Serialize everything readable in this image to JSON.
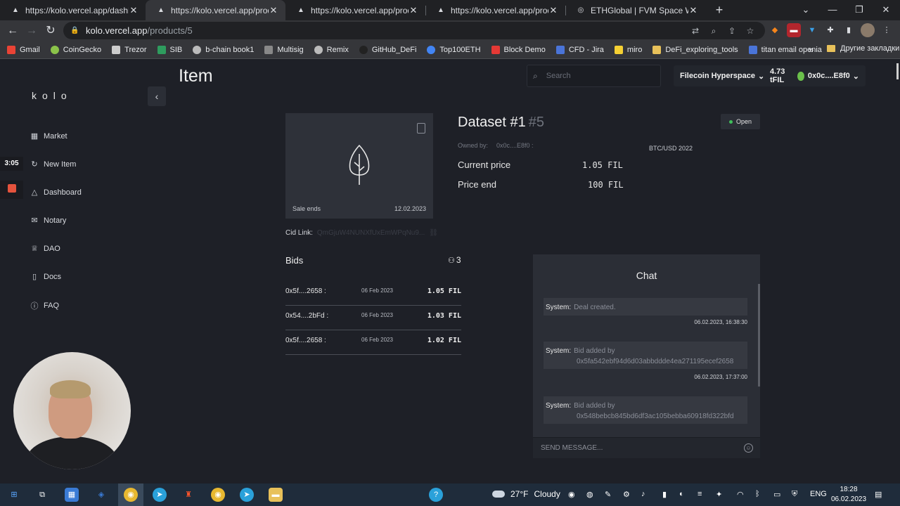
{
  "browser": {
    "tabs": [
      {
        "title": "https://kolo.vercel.app/dashboar",
        "close": "✕",
        "icon": "▲"
      },
      {
        "title": "https://kolo.vercel.app/products/",
        "close": "✕",
        "icon": "▲"
      },
      {
        "title": "https://kolo.vercel.app/products/",
        "close": "✕",
        "icon": "▲"
      },
      {
        "title": "https://kolo.vercel.app/products/",
        "close": "✕",
        "icon": "▲"
      },
      {
        "title": "ETHGlobal | FVM Space Warp",
        "close": "✕",
        "icon": "◎"
      }
    ],
    "new_tab": "+",
    "url_host": "kolo.vercel.app",
    "url_path": "/products/5",
    "bookmarks": [
      "Gmail",
      "CoinGecko",
      "Trezor",
      "SIB",
      "b-chain book1",
      "Multisig",
      "Remix",
      "GitHub_DeFi",
      "Top100ETH",
      "Block Demo",
      "CFD - Jira",
      "miro",
      "DeFi_exploring_tools",
      "titan email openia"
    ],
    "bookmarks_more": "»",
    "other_bookmarks": "Другие закладки",
    "bookmark_colors": [
      "#ea4335",
      "#8bc34a",
      "#cccccc",
      "#2e9c5e",
      "#bbbbbb",
      "#888888",
      "#bbbbbb",
      "#222222",
      "#4285f4",
      "#e53935",
      "#4a74d8",
      "#f5d033",
      "#e8c15a",
      "#4a74d8"
    ]
  },
  "recording": {
    "time": "3:05"
  },
  "app": {
    "logo": "kolo",
    "page_title": "Item",
    "search_placeholder": "Search",
    "network": "Filecoin Hyperspace",
    "balance": "4.73 tFIL",
    "wallet": "0x0c....E8f0",
    "nav": [
      {
        "label": "Market",
        "icon": "grid-icon"
      },
      {
        "label": "New Item",
        "icon": "refresh-icon"
      },
      {
        "label": "Dashboard",
        "icon": "bell-icon"
      },
      {
        "label": "Notary",
        "icon": "mail-icon"
      },
      {
        "label": "DAO",
        "icon": "trophy-icon"
      },
      {
        "label": "Docs",
        "icon": "document-icon"
      },
      {
        "label": "FAQ",
        "icon": "info-icon"
      }
    ],
    "item": {
      "sale_ends_label": "Sale ends",
      "sale_ends_date": "12.02.2023",
      "title": "Dataset #1",
      "number": "#5",
      "status": "Open",
      "owned_by_label": "Owned by:",
      "owner": "0x0c....E8f0 :",
      "pair": "BTC/USD 2022",
      "current_price_label": "Current price",
      "current_price": "1.05 FIL",
      "price_end_label": "Price end",
      "price_end": "100 FIL",
      "cid_label": "Cid Link:",
      "cid_value": "QmGjuW4NUNXfUxEmWPqNu9..."
    },
    "bids": {
      "title": "Bids",
      "count": "3",
      "rows": [
        {
          "address": "0x5f....2658 :",
          "date": "06 Feb 2023",
          "price": "1.05 FIL"
        },
        {
          "address": "0x54....2bFd :",
          "date": "06 Feb 2023",
          "price": "1.03 FIL"
        },
        {
          "address": "0x5f....2658 :",
          "date": "06 Feb 2023",
          "price": "1.02 FIL"
        }
      ]
    },
    "chat": {
      "title": "Chat",
      "messages": [
        {
          "sender": "System:",
          "line1": "Deal created.",
          "line2": "",
          "time": "06.02.2023, 16:38:30"
        },
        {
          "sender": "System:",
          "line1": "Bid added by",
          "line2": "0x5fa542ebf94d6d03abbddde4ea271195ecef2658",
          "time": "06.02.2023, 17:37:00"
        },
        {
          "sender": "System:",
          "line1": "Bid added by",
          "line2": "0x548bebcb845bd6df3ac105bebba60918fd322bfd",
          "time": ""
        }
      ],
      "send_placeholder": "SEND MESSAGE..."
    }
  },
  "taskbar": {
    "weather_temp": "27°F",
    "weather_text": "Cloudy",
    "lang": "ENG",
    "time": "18:28",
    "date": "06.02.2023"
  }
}
